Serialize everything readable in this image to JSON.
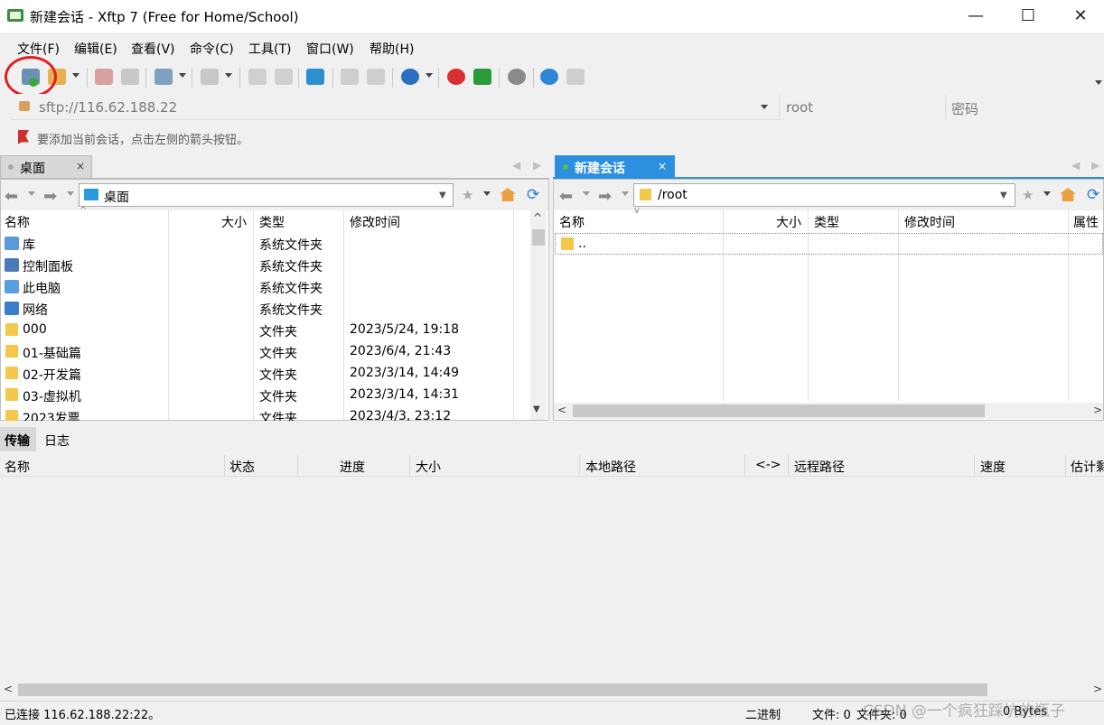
{
  "window": {
    "title": "新建会话 - Xftp 7 (Free for Home/School)",
    "minimize": "—",
    "maximize": "☐",
    "close": "✕"
  },
  "menu": [
    "文件(F)",
    "编辑(E)",
    "查看(V)",
    "命令(C)",
    "工具(T)",
    "窗口(W)",
    "帮助(H)"
  ],
  "address": {
    "host": "sftp://116.62.188.22",
    "username_placeholder": "root",
    "password_placeholder": "密码"
  },
  "hint": "要添加当前会话，点击左侧的箭头按钮。",
  "left_tab": {
    "label": "桌面",
    "close": "×"
  },
  "right_tab": {
    "label": "新建会话",
    "close": "×"
  },
  "left_pane": {
    "path": "桌面",
    "columns": [
      "名称",
      "大小",
      "类型",
      "修改时间"
    ],
    "rows": [
      {
        "name": "库",
        "size": "",
        "type": "系统文件夹",
        "modified": ""
      },
      {
        "name": "控制面板",
        "size": "",
        "type": "系统文件夹",
        "modified": ""
      },
      {
        "name": "此电脑",
        "size": "",
        "type": "系统文件夹",
        "modified": ""
      },
      {
        "name": "网络",
        "size": "",
        "type": "系统文件夹",
        "modified": ""
      },
      {
        "name": "000",
        "size": "",
        "type": "文件夹",
        "modified": "2023/5/24, 19:18"
      },
      {
        "name": "01-基础篇",
        "size": "",
        "type": "文件夹",
        "modified": "2023/6/4, 21:43"
      },
      {
        "name": "02-开发篇",
        "size": "",
        "type": "文件夹",
        "modified": "2023/3/14, 14:49"
      },
      {
        "name": "03-虚拟机",
        "size": "",
        "type": "文件夹",
        "modified": "2023/3/14, 14:31"
      },
      {
        "name": "2023发票",
        "size": "",
        "type": "文件夹",
        "modified": "2023/4/3, 23:12"
      }
    ]
  },
  "right_pane": {
    "path": "/root",
    "columns": [
      "名称",
      "大小",
      "类型",
      "修改时间",
      "属性"
    ],
    "rows": [
      {
        "name": ".."
      }
    ]
  },
  "transfer": {
    "tabs": [
      "传输",
      "日志"
    ],
    "columns": [
      "名称",
      "状态",
      "进度",
      "大小",
      "本地路径",
      "<->",
      "远程路径",
      "速度",
      "估计剩"
    ]
  },
  "status": {
    "connection": "已连接 116.62.188.22:22。",
    "mode": "二进制",
    "files": "文件: 0",
    "folders": "文件夹: 0",
    "bytes": "0 Bytes"
  },
  "watermark": "CSDN @一个疯狂踩坑的瓶子",
  "colors": {
    "accent": "#2d8fe0",
    "annotation_circle": "#e02020"
  },
  "icons": {
    "app": "xftp-app-icon",
    "lock": "lock-icon",
    "home": "home-icon",
    "refresh": "refresh-icon",
    "favorite": "star-icon"
  }
}
